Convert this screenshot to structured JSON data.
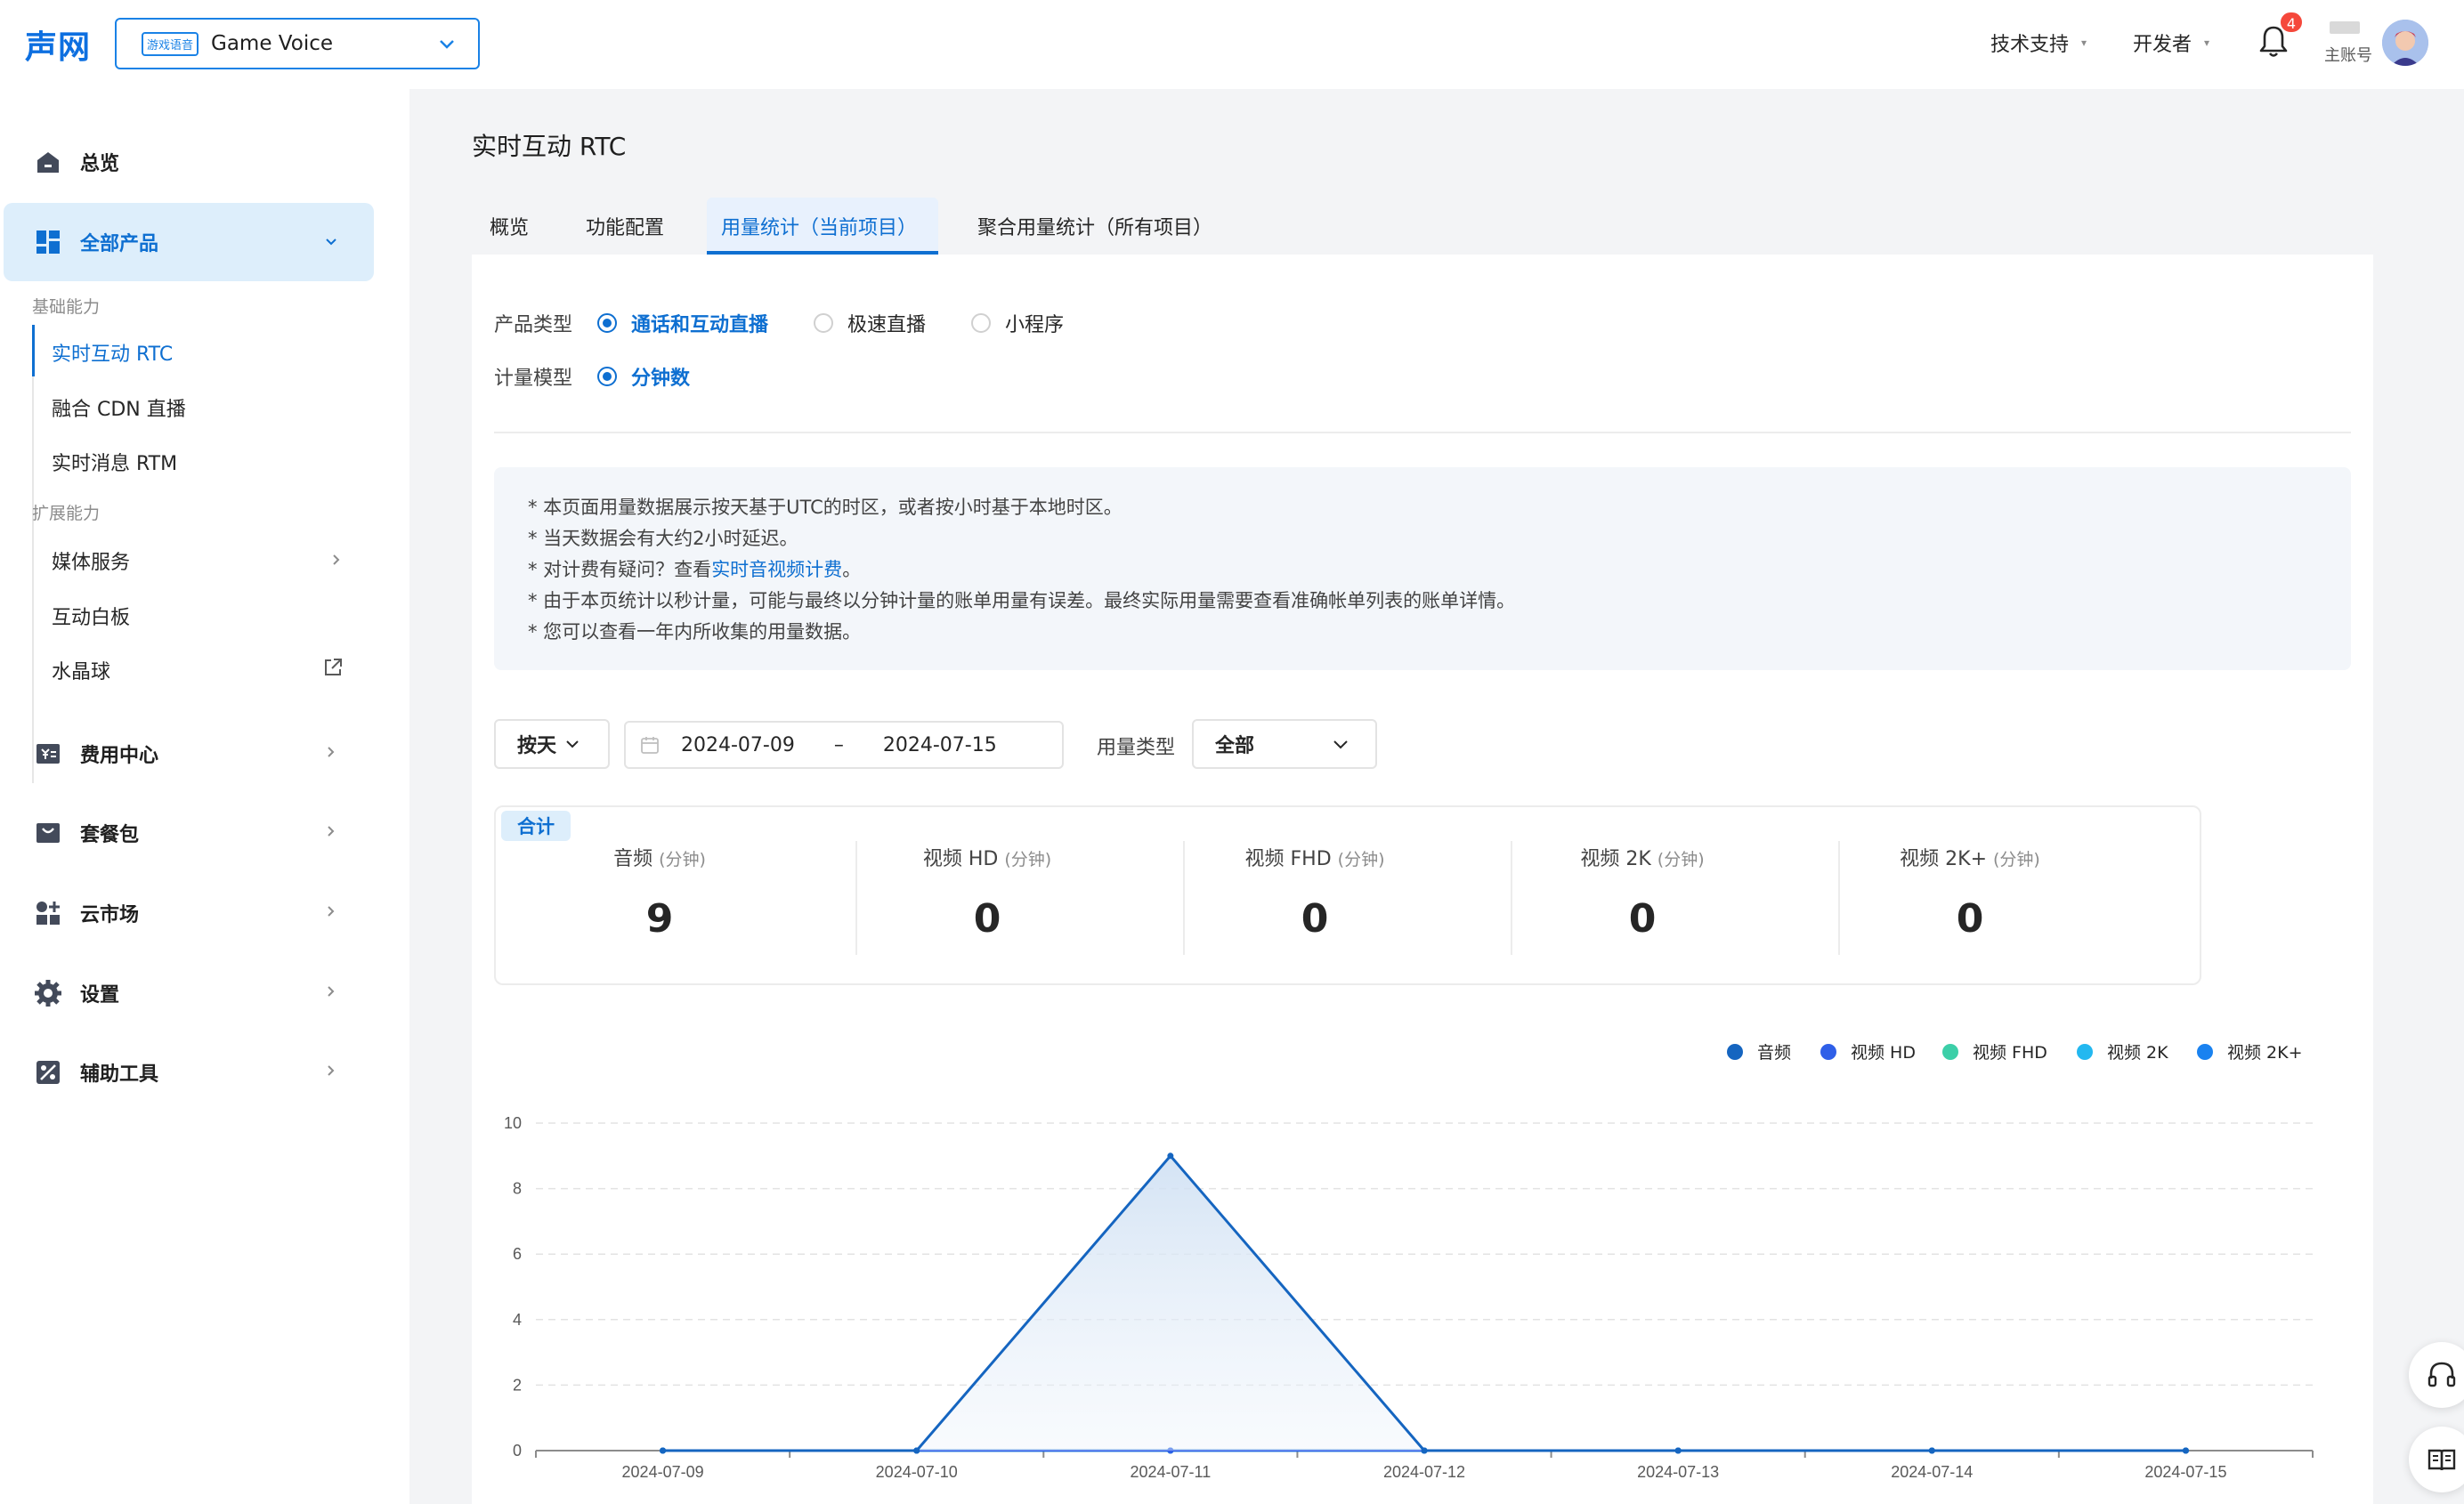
{
  "header": {
    "logo": "声网",
    "project": {
      "tag": "游戏语音",
      "name": "Game Voice"
    },
    "menus": {
      "support": "技术支持",
      "developer": "开发者"
    },
    "notifications": {
      "count": "4"
    },
    "account": {
      "label": "主账号"
    }
  },
  "sidebar": {
    "overview": "总览",
    "all_products": "全部产品",
    "group_basic": "基础能力",
    "basic_items": [
      "实时互动 RTC",
      "融合 CDN 直播",
      "实时消息 RTM"
    ],
    "group_ext": "扩展能力",
    "ext_items": [
      "媒体服务",
      "互动白板",
      "水晶球"
    ],
    "bottom_items": [
      "费用中心",
      "套餐包",
      "云市场",
      "设置",
      "辅助工具"
    ]
  },
  "main": {
    "title": "实时互动 RTC",
    "tabs": [
      "概览",
      "功能配置",
      "用量统计（当前项目）",
      "聚合用量统计（所有项目）"
    ],
    "filters": {
      "product_type_label": "产品类型",
      "product_types": [
        "通话和互动直播",
        "极速直播",
        "小程序"
      ],
      "metering_label": "计量模型",
      "metering_option": "分钟数"
    },
    "notice": {
      "line1": "* 本页面用量数据展示按天基于UTC的时区，或者按小时基于本地时区。",
      "line2": "* 当天数据会有大约2小时延迟。",
      "line3_prefix": "* 对计费有疑问？查看",
      "line3_link": "实时音视频计费",
      "line3_suffix": "。",
      "line4": "* 由于本页统计以秒计量，可能与最终以分钟计量的账单用量有误差。最终实际用量需要查看准确帐单列表的账单详情。",
      "line5": "* 您可以查看一年内所收集的用量数据。"
    },
    "controls": {
      "granularity": "按天",
      "date_start": "2024-07-09",
      "date_sep": "–",
      "date_end": "2024-07-15",
      "usage_type_label": "用量类型",
      "usage_type_value": "全部"
    },
    "summary": {
      "badge": "合计",
      "unit": "(分钟)",
      "items": [
        {
          "label": "音频",
          "value": "9"
        },
        {
          "label": "视频 HD",
          "value": "0"
        },
        {
          "label": "视频 FHD",
          "value": "0"
        },
        {
          "label": "视频 2K",
          "value": "0"
        },
        {
          "label": "视频 2K+",
          "value": "0"
        }
      ]
    }
  },
  "colors": {
    "accent": "#0e6fd1",
    "series": [
      "#1565c0",
      "#2f5fe8",
      "#3ccfa8",
      "#23b8f0",
      "#1a82f0"
    ]
  },
  "chart_data": {
    "type": "area",
    "categories": [
      "2024-07-09",
      "2024-07-10",
      "2024-07-11",
      "2024-07-12",
      "2024-07-13",
      "2024-07-14",
      "2024-07-15"
    ],
    "series": [
      {
        "name": "音频",
        "values": [
          0,
          0,
          9,
          0,
          0,
          0,
          0
        ]
      },
      {
        "name": "视频 HD",
        "values": [
          0,
          0,
          0,
          0,
          0,
          0,
          0
        ]
      },
      {
        "name": "视频 FHD",
        "values": [
          0,
          0,
          0,
          0,
          0,
          0,
          0
        ]
      },
      {
        "name": "视频 2K",
        "values": [
          0,
          0,
          0,
          0,
          0,
          0,
          0
        ]
      },
      {
        "name": "视频 2K+",
        "values": [
          0,
          0,
          0,
          0,
          0,
          0,
          0
        ]
      }
    ],
    "ylim": [
      0,
      10
    ],
    "yticks": [
      0,
      2,
      4,
      6,
      8,
      10
    ],
    "grid": true,
    "legend": "top-right"
  }
}
